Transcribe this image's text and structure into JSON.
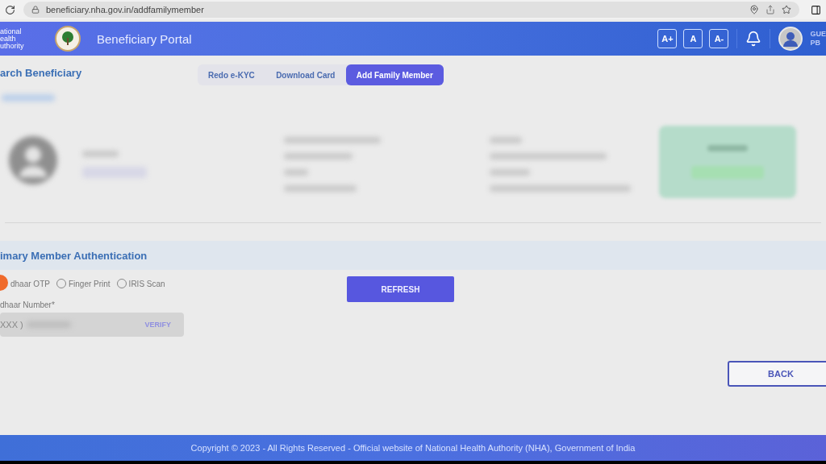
{
  "browser": {
    "url": "beneficiary.nha.gov.in/addfamilymember"
  },
  "header": {
    "logo_lines": [
      "ational",
      "ealth",
      "uthority"
    ],
    "title": "Beneficiary Portal",
    "font_buttons": [
      "A+",
      "A",
      "A-"
    ],
    "user": {
      "name": "GUE",
      "code": "PB"
    }
  },
  "page_title": "arch Beneficiary",
  "tabs": [
    {
      "label": "Redo e-KYC",
      "selected": false
    },
    {
      "label": "Download Card",
      "selected": false
    },
    {
      "label": "Add Family Member",
      "selected": true
    }
  ],
  "authentication": {
    "title": "imary Member Authentication",
    "options": [
      {
        "label": "dhaar OTP",
        "kind": "covered"
      },
      {
        "label": "Finger Print",
        "kind": "radio",
        "selected": false
      },
      {
        "label": "IRIS Scan",
        "kind": "radio",
        "selected": false
      }
    ],
    "field": {
      "label": "dhaar Number*",
      "value": "XXX )",
      "action": "VERIFY"
    },
    "refresh": "REFRESH"
  },
  "back": "BACK",
  "footer": "Copyright © 2023 - All Rights Reserved - Official website of National Health Authority (NHA), Government of India"
}
